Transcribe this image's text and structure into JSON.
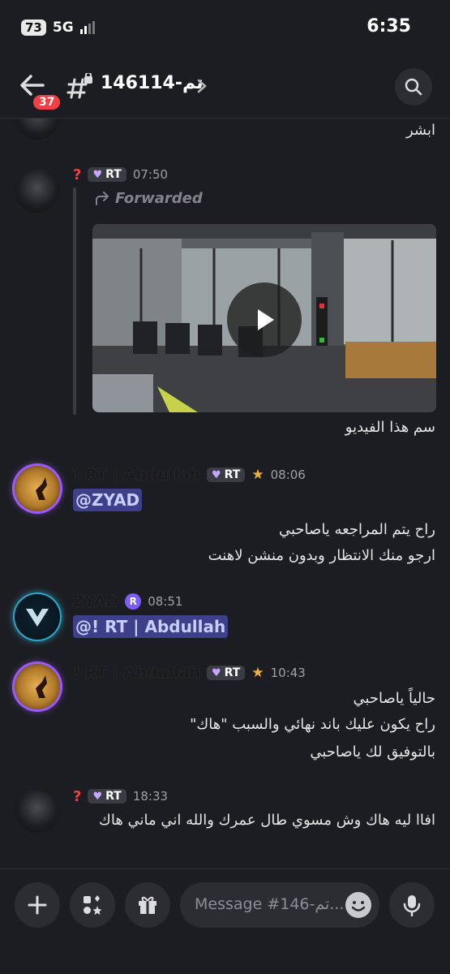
{
  "status_bar": {
    "battery": "73",
    "network": "5G",
    "time": "6:35"
  },
  "header": {
    "unread_badge": "37",
    "channel_name": "تم-146114"
  },
  "messages": [
    {
      "text": "ابشر"
    },
    {
      "role_tag": "RT",
      "time": "07:50",
      "forwarded_label": "Forwarded",
      "caption": "سم هذا الفيديو"
    },
    {
      "username": "! RT | Abdullah",
      "role_tag": "RT",
      "time": "08:06",
      "mention": "@ZYAD",
      "lines": [
        "راح يتم المراجعه ياصاحبي",
        "ارجو منك الانتظار وبدون منشن لاهنت"
      ]
    },
    {
      "username": "ZYAD",
      "time": "08:51",
      "mention": "@! RT | Abdullah"
    },
    {
      "username": "! RT | Abdullah",
      "role_tag": "RT",
      "time": "10:43",
      "lines": [
        "حالياً ياصاحبي",
        "راح يكون عليك باند نهائي والسبب \"هاك\"",
        "بالتوفيق لك ياصاحبي"
      ]
    },
    {
      "role_tag": "RT",
      "time": "18:33",
      "lines": [
        "افاا ليه هاك وش مسوي طال عمرك والله اني ماني هاك"
      ]
    }
  ],
  "composer": {
    "placeholder": "Message #تم-146..."
  },
  "colors": {
    "background": "#1c1d22",
    "mention_bg": "#3c3f8a",
    "accent": "#5865f2",
    "badge_red": "#f23f43"
  }
}
